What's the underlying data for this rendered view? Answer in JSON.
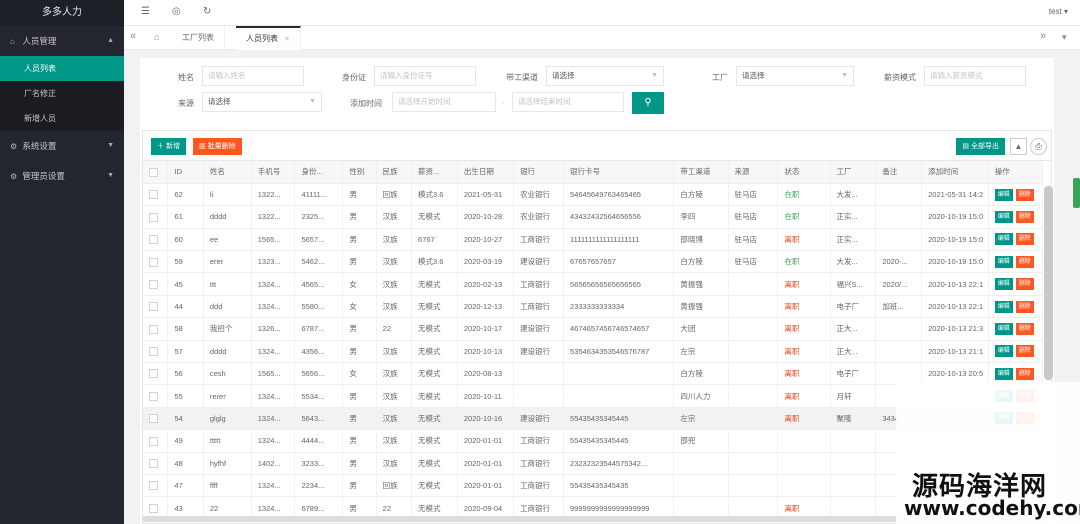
{
  "sidebar": {
    "brand": "多多人力",
    "groups": [
      {
        "label": "人员管理",
        "items": [
          {
            "label": "人员列表"
          },
          {
            "label": "厂名修正"
          },
          {
            "label": "新增人员"
          }
        ]
      },
      {
        "label": "系统设置"
      },
      {
        "label": "管理员设置"
      }
    ]
  },
  "header": {
    "user": "test"
  },
  "tabs": [
    {
      "label": "工厂列表"
    },
    {
      "label": "人员列表"
    }
  ],
  "form": {
    "name_label": "姓名",
    "name_placeholder": "请输入姓名",
    "idcard_label": "身份证",
    "idcard_placeholder": "请输入身份证号",
    "channel_label": "带工渠道",
    "channel_value": "请选择",
    "factory_label": "工厂",
    "factory_value": "请选择",
    "salary_label": "薪资模式",
    "salary_placeholder": "请输入薪资模式",
    "source_label": "来源",
    "source_value": "请选择",
    "addtime_label": "添加时间",
    "start_placeholder": "请选择开始时间",
    "end_placeholder": "请选择结束时间"
  },
  "toolbar": {
    "add": "新增",
    "batch_delete": "批量删除",
    "export_all": "全部导出"
  },
  "table": {
    "columns": [
      "ID",
      "姓名",
      "手机号",
      "身份...",
      "性别",
      "民族",
      "薪资...",
      "出生日期",
      "银行",
      "银行卡号",
      "带工渠道",
      "来源",
      "状态",
      "工厂",
      "备注",
      "添加时间",
      "操作"
    ],
    "edit_label": "编辑",
    "delete_label": "删除",
    "rows": [
      {
        "id": "62",
        "name": "li",
        "phone": "1322...",
        "idno": "41111...",
        "gender": "男",
        "nation": "回族",
        "salary": "模式3.6",
        "birth": "2021-05-31",
        "bank": "农业银行",
        "card": "54645649763465465",
        "channel": "白方陵",
        "source": "驻马店",
        "status": "在职",
        "factory": "大发...",
        "remark": "",
        "added": "2021-05-31 14:2"
      },
      {
        "id": "61",
        "name": "dddd",
        "phone": "1322...",
        "idno": "2325...",
        "gender": "男",
        "nation": "汉族",
        "salary": "无模式",
        "birth": "2020-10-28",
        "bank": "农业银行",
        "card": "43432432564656556",
        "channel": "李四",
        "source": "驻马店",
        "status": "在职",
        "factory": "正实...",
        "remark": "",
        "added": "2020-10-19 15:0"
      },
      {
        "id": "60",
        "name": "ee",
        "phone": "1565...",
        "idno": "5657...",
        "gender": "男",
        "nation": "汉族",
        "salary": "6767",
        "birth": "2020-10-27",
        "bank": "工商银行",
        "card": "1111111111111111111",
        "channel": "邵晓博",
        "source": "驻马店",
        "status": "离职",
        "factory": "正实...",
        "remark": "",
        "added": "2020-10-19 15:0"
      },
      {
        "id": "59",
        "name": "erer",
        "phone": "1323...",
        "idno": "5462...",
        "gender": "男",
        "nation": "汉族",
        "salary": "模式3.6",
        "birth": "2020-03-19",
        "bank": "建设银行",
        "card": "67657657657",
        "channel": "白方陵",
        "source": "驻马店",
        "status": "在职",
        "factory": "大发...",
        "remark": "2020-...",
        "added": "2020-10-19 15:0"
      },
      {
        "id": "45",
        "name": "ttt",
        "phone": "1324...",
        "idno": "4565...",
        "gender": "女",
        "nation": "汉族",
        "salary": "无模式",
        "birth": "2020-02-13",
        "bank": "工商银行",
        "card": "56565656565656565",
        "channel": "黄振强",
        "source": "",
        "status": "离职",
        "factory": "福兴S...",
        "remark": "2020/...",
        "added": "2020-10-13 22:1"
      },
      {
        "id": "44",
        "name": "ddd",
        "phone": "1324...",
        "idno": "5580...",
        "gender": "女",
        "nation": "汉族",
        "salary": "无模式",
        "birth": "2020-12-13",
        "bank": "工商银行",
        "card": "2333333333334",
        "channel": "黄振强",
        "source": "",
        "status": "离职",
        "factory": "电子厂",
        "remark": "加班...",
        "added": "2020-10-13 22:1"
      },
      {
        "id": "58",
        "name": "我招个",
        "phone": "1326...",
        "idno": "6787...",
        "gender": "男",
        "nation": "22",
        "salary": "无模式",
        "birth": "2020-10-17",
        "bank": "建设银行",
        "card": "4674657456746574657",
        "channel": "大团",
        "source": "",
        "status": "离职",
        "factory": "正大...",
        "remark": "",
        "added": "2020-10-13 21:3"
      },
      {
        "id": "57",
        "name": "dddd",
        "phone": "1324...",
        "idno": "4356...",
        "gender": "男",
        "nation": "汉族",
        "salary": "无模式",
        "birth": "2020-10-13",
        "bank": "建设银行",
        "card": "5354634353546576787",
        "channel": "左宗",
        "source": "",
        "status": "离职",
        "factory": "正大...",
        "remark": "",
        "added": "2020-10-13 21:1"
      },
      {
        "id": "56",
        "name": "cesh",
        "phone": "1565...",
        "idno": "5656...",
        "gender": "女",
        "nation": "汉族",
        "salary": "无模式",
        "birth": "2020-08-13",
        "bank": "",
        "card": "",
        "channel": "白方陵",
        "source": "",
        "status": "离职",
        "factory": "电子厂",
        "remark": "",
        "added": "2020-10-13 20:5"
      },
      {
        "id": "55",
        "name": "rerer",
        "phone": "1324...",
        "idno": "5534...",
        "gender": "男",
        "nation": "汉族",
        "salary": "无模式",
        "birth": "2020-10-11",
        "bank": "",
        "card": "",
        "channel": "四川人力",
        "source": "",
        "status": "离职",
        "factory": "月轩",
        "remark": "",
        "added": ""
      },
      {
        "id": "54",
        "name": "glglg",
        "phone": "1324...",
        "idno": "5643...",
        "gender": "男",
        "nation": "汉族",
        "salary": "无模式",
        "birth": "2020-10-16",
        "bank": "建设银行",
        "card": "55435435345445",
        "channel": "左宗",
        "source": "",
        "status": "离职",
        "factory": "聚隆",
        "remark": "3434...",
        "added": ""
      },
      {
        "id": "49",
        "name": "ttttt",
        "phone": "1324...",
        "idno": "4444...",
        "gender": "男",
        "nation": "汉族",
        "salary": "无模式",
        "birth": "2020-01-01",
        "bank": "工商银行",
        "card": "55435435345445",
        "channel": "邵兜",
        "source": "",
        "status": "",
        "factory": "",
        "remark": "",
        "added": ""
      },
      {
        "id": "48",
        "name": "hyfhf",
        "phone": "1402...",
        "idno": "3233...",
        "gender": "男",
        "nation": "汉族",
        "salary": "无模式",
        "birth": "2020-01-01",
        "bank": "工商银行",
        "card": "23232323544575342...",
        "channel": "",
        "source": "",
        "status": "",
        "factory": "",
        "remark": "",
        "added": ""
      },
      {
        "id": "47",
        "name": "ffff",
        "phone": "1324...",
        "idno": "2234...",
        "gender": "男",
        "nation": "回族",
        "salary": "无模式",
        "birth": "2020-01-01",
        "bank": "工商银行",
        "card": "55435435345435",
        "channel": "",
        "source": "",
        "status": "",
        "factory": "",
        "remark": "",
        "added": ""
      },
      {
        "id": "43",
        "name": "22",
        "phone": "1324...",
        "idno": "6789...",
        "gender": "男",
        "nation": "22",
        "salary": "无模式",
        "birth": "2020-09-04",
        "bank": "工商银行",
        "card": "9999999999999999999",
        "channel": "",
        "source": "",
        "status": "离职",
        "factory": "",
        "remark": "",
        "added": ""
      }
    ]
  },
  "watermark": {
    "main": "源码海洋网",
    "sub": "www.codehy.com"
  }
}
